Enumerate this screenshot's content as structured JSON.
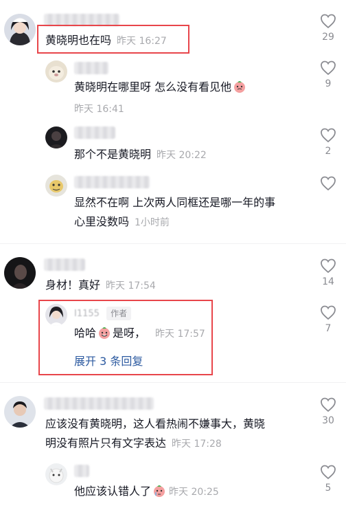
{
  "comments": [
    {
      "text": "黄晓明也在吗",
      "time": "昨天 16:27",
      "likes": "29"
    },
    {
      "text": "黄晓明在哪里呀 怎么没有看见他",
      "time": "昨天 16:41",
      "likes": "9"
    },
    {
      "text": "那个不是黄晓明",
      "time": "昨天 20:22",
      "likes": "2"
    },
    {
      "text_line1": "显然不在啊 上次两人同框还是哪一年的事",
      "text_line2": "心里没数吗",
      "time": "1小时前",
      "likes": ""
    },
    {
      "text": "身材！真好",
      "time": "昨天 17:54",
      "likes": "14"
    },
    {
      "username_partial": "I1155",
      "author_badge": "作者",
      "text_a": "哈哈",
      "text_b": "是呀，",
      "time": "昨天 17:57",
      "likes": "7",
      "expand": "展开 3 条回复"
    },
    {
      "text_line1": "应该没有黄晓明，这人看热闹不嫌事大，黄晓",
      "text_line2": "明没有照片只有文字表达",
      "time": "昨天 17:28",
      "likes": "30"
    },
    {
      "text": "他应该认错人了",
      "time": "昨天 20:25",
      "likes": "5"
    }
  ],
  "colors": {
    "highlight_box": "#e8454a",
    "meta": "#a8a9ad",
    "link": "#2c5aa0"
  }
}
